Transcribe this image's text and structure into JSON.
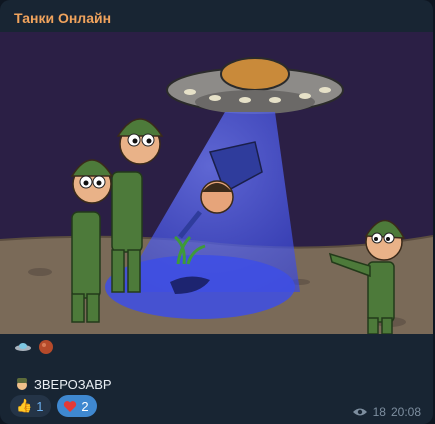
{
  "post": {
    "channel_name": "Танки Онлайн",
    "caption_icons": [
      "ufo-emoji",
      "planet-emoji"
    ],
    "author_signature": "ЗВЕРОЗАВР",
    "author_icon": "soldier-emoji",
    "reactions": [
      {
        "icon": "thumbs-up-emoji",
        "count": "1"
      },
      {
        "icon": "heart-emoji",
        "count": "2"
      }
    ],
    "views": "18",
    "time": "20:08"
  },
  "colors": {
    "bubble": "#182533",
    "channel_name": "#f0a35d",
    "reaction_active": "#3f88d0"
  }
}
